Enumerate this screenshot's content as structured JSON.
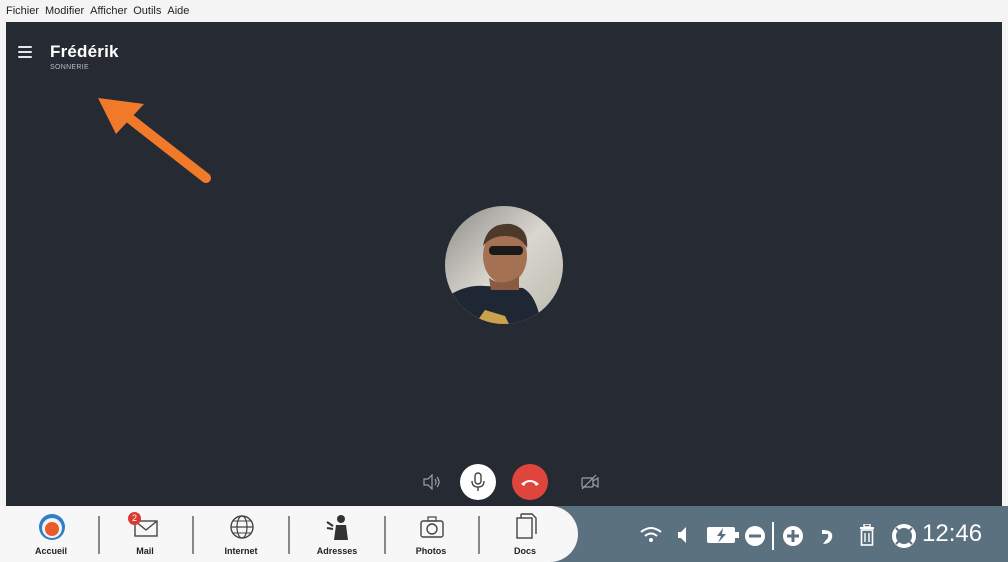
{
  "menu": {
    "items": [
      "Fichier",
      "Modifier",
      "Afficher",
      "Outils",
      "Aide"
    ]
  },
  "call": {
    "caller_name": "Frédérik",
    "status": "SONNERIE"
  },
  "taskbar": {
    "apps": [
      {
        "label": "Accueil"
      },
      {
        "label": "Mail",
        "badge": "2"
      },
      {
        "label": "Internet"
      },
      {
        "label": "Adresses"
      },
      {
        "label": "Photos"
      },
      {
        "label": "Docs"
      }
    ],
    "clock": "12:46"
  },
  "colors": {
    "call_background": "#252a33",
    "hangup": "#e0453d",
    "arrow": "#f07a2a",
    "taskbar": "#5c7180"
  }
}
